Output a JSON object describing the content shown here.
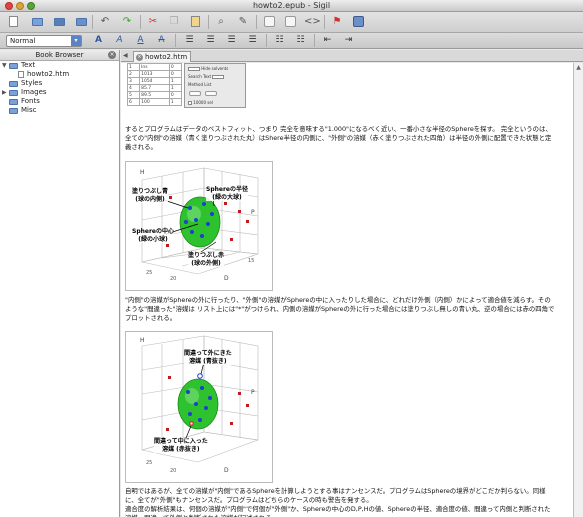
{
  "window": {
    "title": "howto2.epub - Sigil"
  },
  "toolbar": {
    "paragraph_style": "Normal",
    "icons": [
      "new-file-icon",
      "open-folder-icon",
      "save-icon",
      "save-as-icon",
      "undo-icon",
      "redo-icon",
      "cut-icon",
      "copy-icon",
      "paste-icon",
      "find-replace-icon",
      "book-view-icon",
      "split-view-icon",
      "code-view-icon",
      "spellcheck-icon",
      "meta-editor-icon"
    ]
  },
  "book_browser": {
    "title": "Book Browser",
    "items": [
      {
        "label": "Text",
        "type": "folder",
        "expanded": true
      },
      {
        "label": "howto2.htm",
        "type": "file"
      },
      {
        "label": "Styles",
        "type": "folder"
      },
      {
        "label": "Images",
        "type": "folder"
      },
      {
        "label": "Fonts",
        "type": "folder"
      },
      {
        "label": "Misc",
        "type": "folder"
      }
    ]
  },
  "editor": {
    "tab": "howto2.htm",
    "para1": "するとプログラムはデータのベストフィット、つまり 完全を意味する\"1.000\"になるべく近い、一番小さな半径のSphereを探す。 完全というのは、全ての\"内側\"の溶媒（青く塗りつぶされた丸）はShere半径の内側に、\"外側\"の溶媒（赤く塗りつぶされた四角）は半径の外側に配置できた状態と定義される。",
    "fig1": {
      "filled_blue": "塗りつぶし青\n(球の内側)",
      "sphere_radius": "Sphereの半径\n(緑の大球)",
      "sphere_center": "Sphereの中心\n(緑の小球)",
      "filled_red": "塗りつぶし赤\n(球の外側)",
      "axis_h": "H",
      "axis_p": "P",
      "axis_d": "D",
      "tick_left": "25",
      "tick_mid": "20",
      "tick_right": "15"
    },
    "para2": "\"内側\"の溶媒がSphereの外に行ったり、\"外側\"の溶媒がSphereの中に入ったりした場合に、どれだけ外側（内側）かによって適合値を減らす。そのような\"間違った\"溶媒は リスト上には\"*\"がつけられ、内側の溶媒がSphereの外に行った場合には塗りつぶし無しの青い丸、逆の場合には赤の四角でプロットされる。",
    "fig2": {
      "wrong_out": "間違って外にきた\n溶媒 (青抜き)",
      "wrong_in": "間違って中に入った\n溶媒 (赤抜き)",
      "axis_h": "H",
      "axis_p": "P",
      "axis_d": "D",
      "tick_left": "25",
      "tick_mid": "20"
    },
    "para3": "自明ではあるが、全ての溶媒が\"内側\"であるSphereを計算しようとする事はナンセンスだ。プログラムはSphereの境界がどこだか判らない。同様に、全てが\"外側\"もナンセンスだ。プログラムはどちらのケースの時も警告を発する。",
    "para4": "適合度の解析結果は、何個の溶媒が\"内側\"で何個が\"外側\"か、Sphereの中心のD,P,Hの値、Sphereの半径、適合度の値、間違って内側と判断された溶媒、間違って外側と判断された溶媒が記述される。",
    "screenshot_snippet": {
      "rows": [
        "Ins",
        "1013",
        "1054",
        "85.7",
        "89.5",
        "100",
        "152.1"
      ],
      "labels": [
        "Hide solvents",
        "Search Text",
        "Method List",
        "10000 sel"
      ]
    }
  },
  "colors": {
    "sphere": "#2ec22e",
    "inside": "#1f3fd1",
    "outside": "#c21a1a"
  }
}
